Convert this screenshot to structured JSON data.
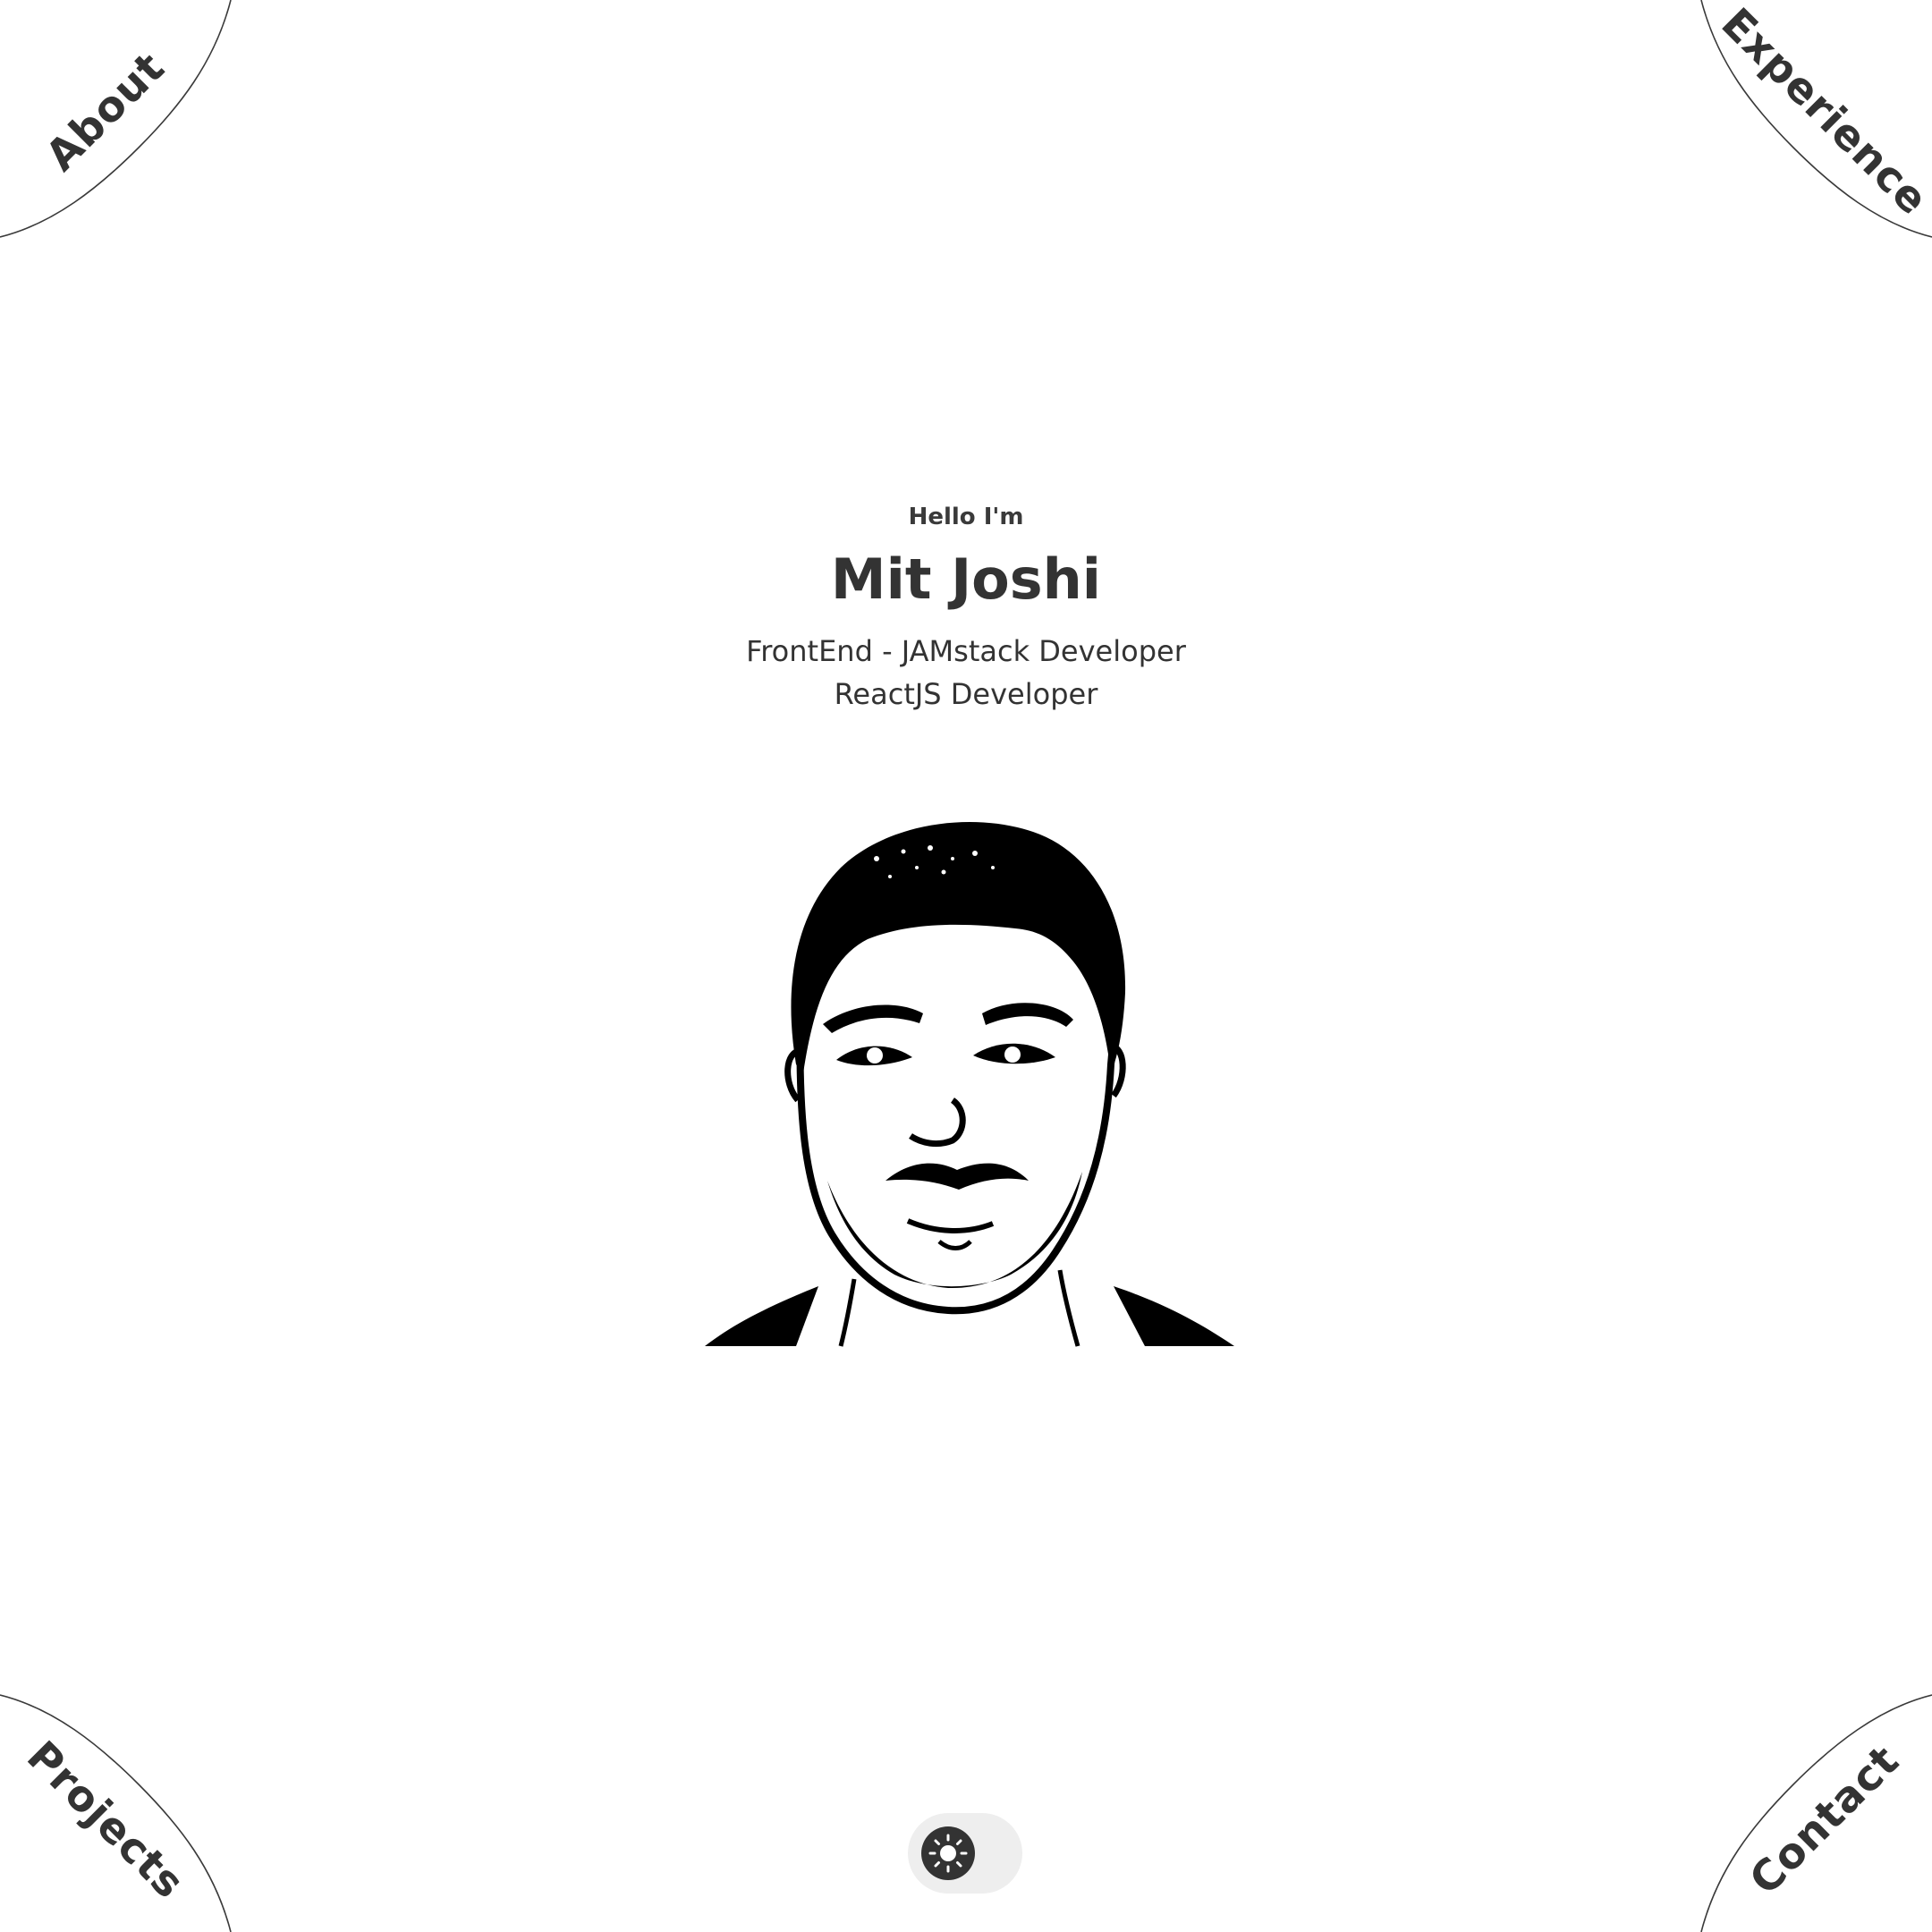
{
  "nav": {
    "about": "About",
    "experience": "Experience",
    "projects": "Projects",
    "contact": "Contact"
  },
  "hero": {
    "greeting": "Hello I'm",
    "name": "Mit Joshi",
    "roles": [
      "FrontEnd - JAMstack Developer",
      "ReactJS Developer"
    ]
  },
  "theme_toggle": {
    "mode": "light",
    "icon": "sun-icon"
  },
  "colors": {
    "text": "#333333",
    "background": "#ffffff",
    "toggle_track": "#eeeeee",
    "toggle_knob": "#333333"
  }
}
